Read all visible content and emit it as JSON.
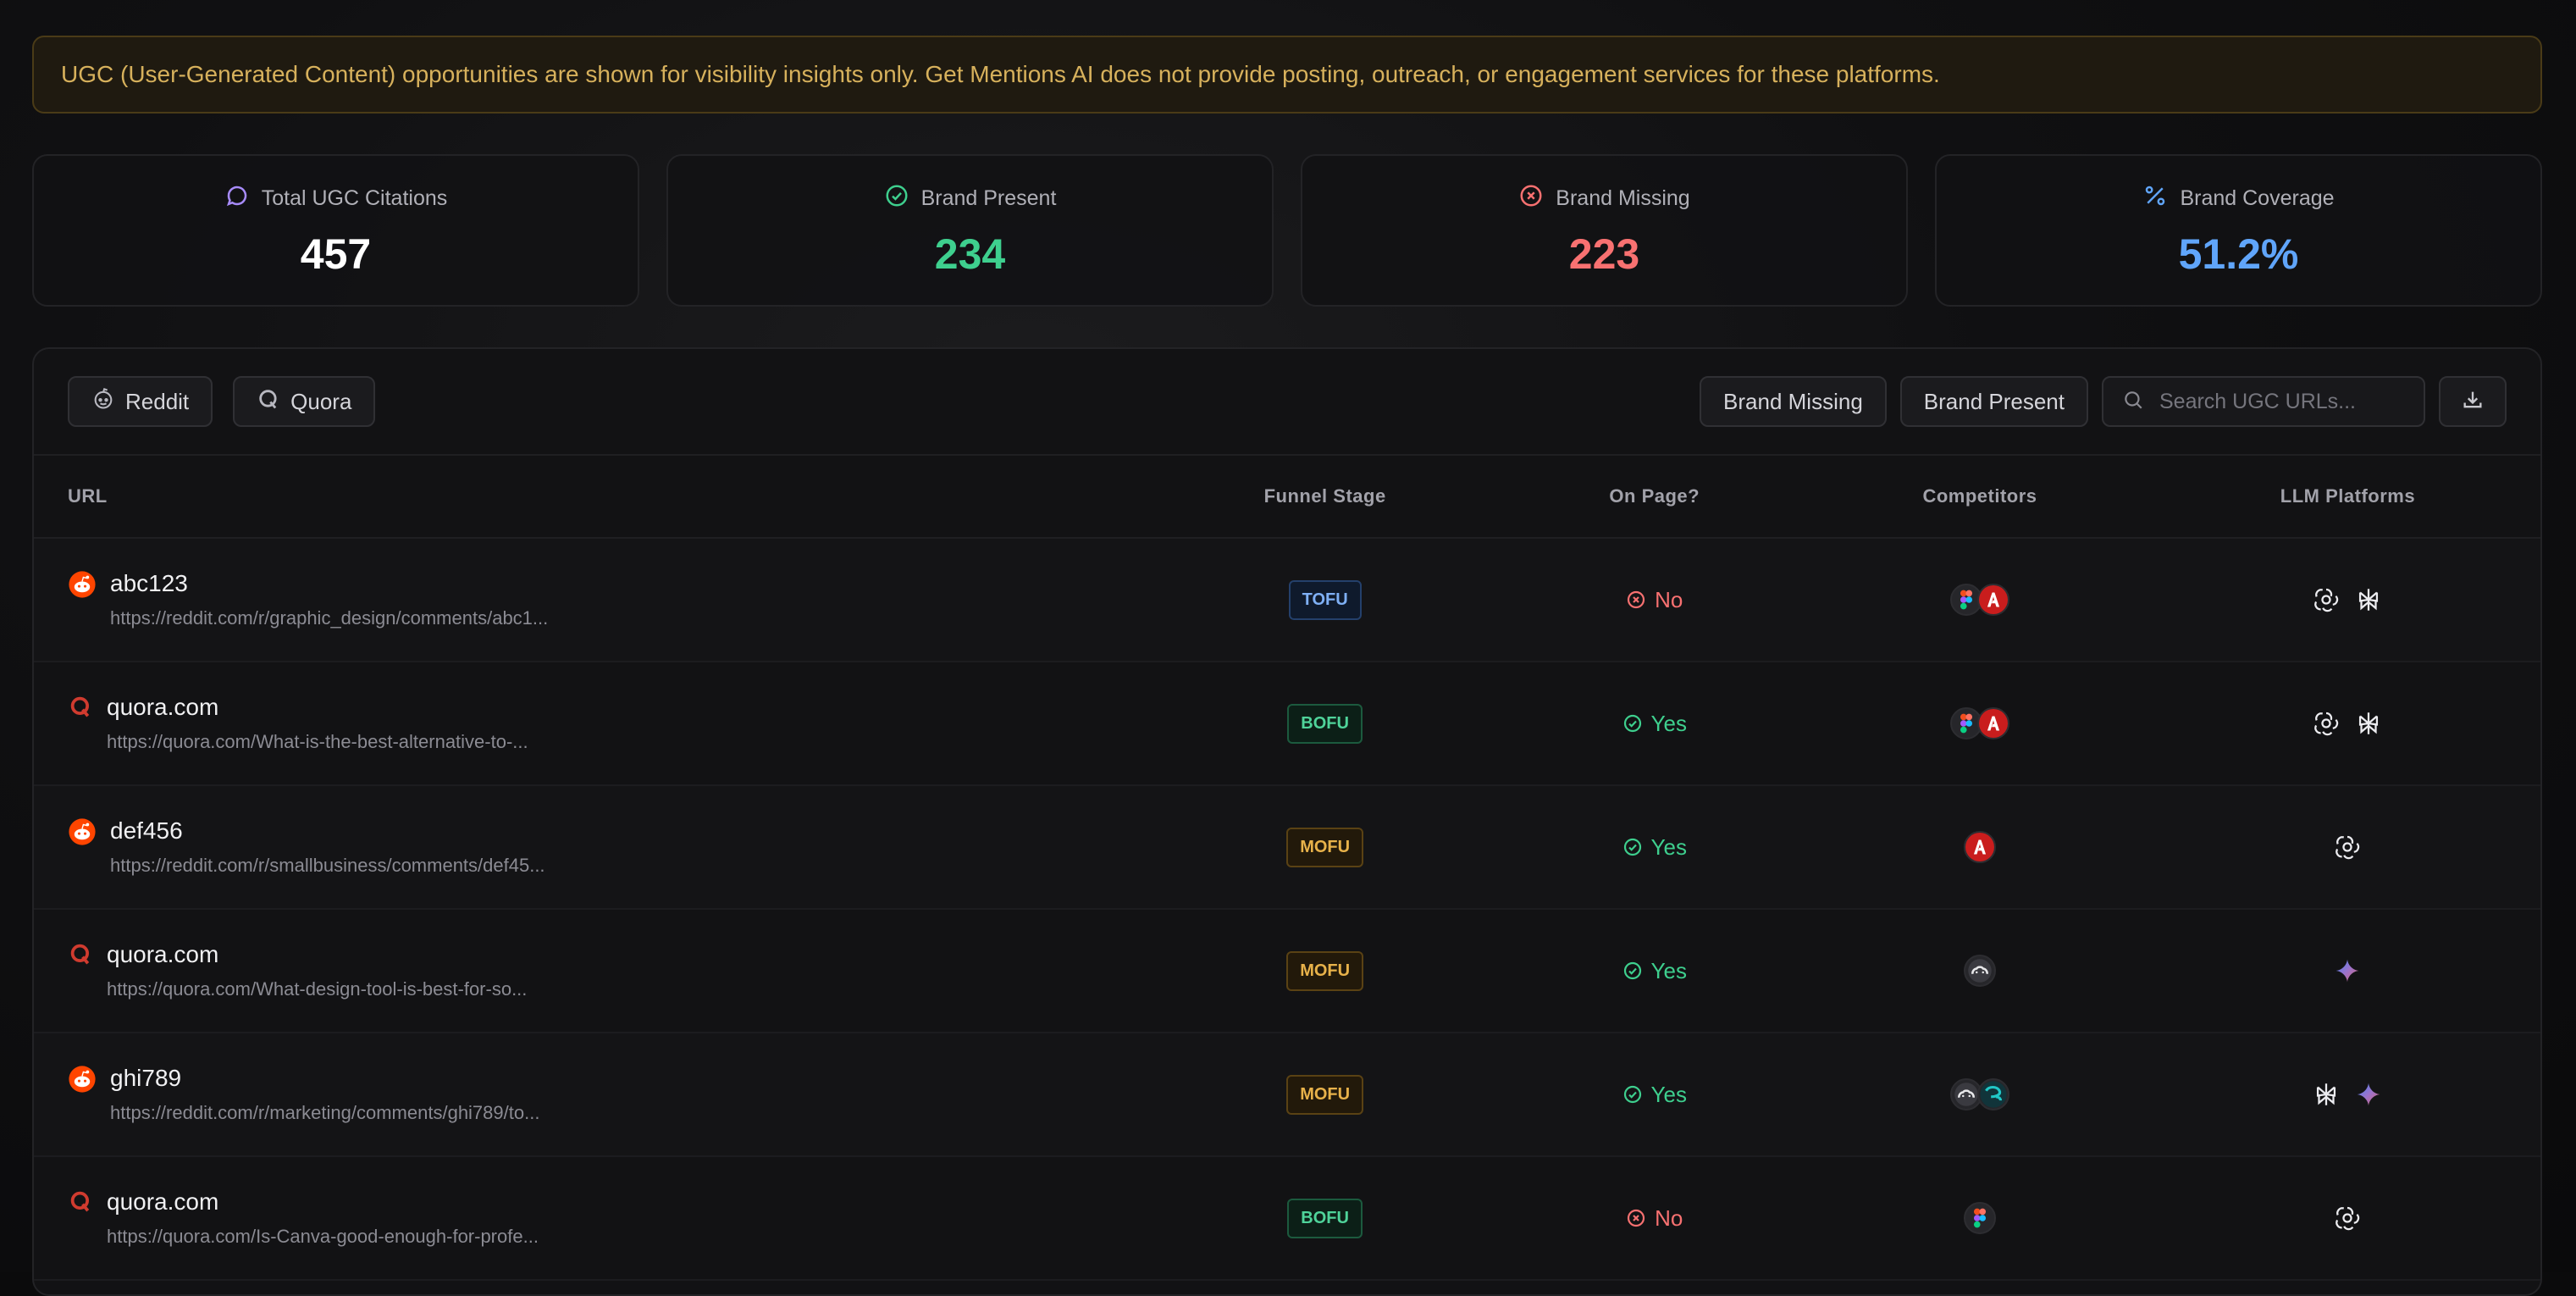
{
  "banner": {
    "text": "UGC (User-Generated Content) opportunities are shown for visibility insights only. Get Mentions AI does not provide posting, outreach, or engagement services for these platforms."
  },
  "stats": [
    {
      "label": "Total UGC Citations",
      "value": "457",
      "icon": "chat-bubble-icon",
      "color": "#ffffff",
      "icon_color": "#a78bfa"
    },
    {
      "label": "Brand Present",
      "value": "234",
      "icon": "check-circle-icon",
      "color": "#3ecf8e",
      "icon_color": "#3ecf8e"
    },
    {
      "label": "Brand Missing",
      "value": "223",
      "icon": "x-circle-icon",
      "color": "#f87171",
      "icon_color": "#f87171"
    },
    {
      "label": "Brand Coverage",
      "value": "51.2%",
      "icon": "percent-icon",
      "color": "#60a5fa",
      "icon_color": "#60a5fa"
    }
  ],
  "toolbar": {
    "reddit_label": "Reddit",
    "quora_label": "Quora",
    "brand_missing_label": "Brand Missing",
    "brand_present_label": "Brand Present",
    "search_placeholder": "Search UGC URLs..."
  },
  "table": {
    "headers": {
      "url": "URL",
      "funnel": "Funnel Stage",
      "onpage": "On Page?",
      "competitors": "Competitors",
      "llm": "LLM Platforms"
    },
    "rows": [
      {
        "source": "reddit",
        "title": "abc123",
        "url": "https://reddit.com/r/graphic_design/comments/abc1...",
        "funnel": "TOFU",
        "onpage": "No",
        "competitors": [
          "figma",
          "adobe"
        ],
        "llms": [
          "openai",
          "perplexity"
        ]
      },
      {
        "source": "quora",
        "title": "quora.com",
        "url": "https://quora.com/What-is-the-best-alternative-to-...",
        "funnel": "BOFU",
        "onpage": "Yes",
        "competitors": [
          "figma",
          "adobe"
        ],
        "llms": [
          "openai",
          "perplexity"
        ]
      },
      {
        "source": "reddit",
        "title": "def456",
        "url": "https://reddit.com/r/smallbusiness/comments/def45...",
        "funnel": "MOFU",
        "onpage": "Yes",
        "competitors": [
          "adobe"
        ],
        "llms": [
          "openai"
        ]
      },
      {
        "source": "quora",
        "title": "quora.com",
        "url": "https://quora.com/What-design-tool-is-best-for-so...",
        "funnel": "MOFU",
        "onpage": "Yes",
        "competitors": [
          "cloud"
        ],
        "llms": [
          "gemini"
        ]
      },
      {
        "source": "reddit",
        "title": "ghi789",
        "url": "https://reddit.com/r/marketing/comments/ghi789/to...",
        "funnel": "MOFU",
        "onpage": "Yes",
        "competitors": [
          "cloud",
          "teal"
        ],
        "llms": [
          "perplexity",
          "gemini"
        ]
      },
      {
        "source": "quora",
        "title": "quora.com",
        "url": "https://quora.com/Is-Canva-good-enough-for-profe...",
        "funnel": "BOFU",
        "onpage": "No",
        "competitors": [
          "figma"
        ],
        "llms": [
          "openai"
        ]
      }
    ]
  },
  "funnel_colors": {
    "TOFU": {
      "fg": "#7fb0f5",
      "bg": "#0f1a2c",
      "border": "#24406b"
    },
    "MOFU": {
      "fg": "#e8b24a",
      "bg": "#22190a",
      "border": "#5a4214"
    },
    "BOFU": {
      "fg": "#4fd39a",
      "bg": "#0c1f17",
      "border": "#1c5a3e"
    }
  },
  "onpage_colors": {
    "Yes": "#3ecf8e",
    "No": "#f87171"
  }
}
